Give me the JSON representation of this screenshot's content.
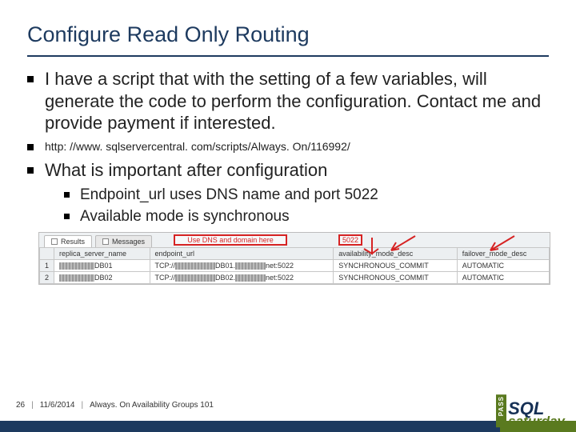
{
  "title": "Configure Read Only Routing",
  "bullets": {
    "b1": "I have a script that with the setting of a few variables, will generate the code to perform the configuration. Contact me and provide payment if interested.",
    "b2": "http: //www. sqlservercentral. com/scripts/Always. On/116992/",
    "b3": "What is important after configuration",
    "b3a": "Endpoint_url uses DNS name and port 5022",
    "b3b": "Available mode is synchronous"
  },
  "shot": {
    "tab1": "Results",
    "tab2": "Messages",
    "callout_dns": "Use DNS and domain here",
    "callout_port": "5022",
    "cols": {
      "c1": "replica_server_name",
      "c2": "endpoint_url",
      "c3": "availability_mode_desc",
      "c4": "failover_mode_desc"
    },
    "rows": [
      {
        "n": "1",
        "c1a": "DB01",
        "c2a": "TCP://",
        "c2b": "DB01.",
        "c2c": "net:5022",
        "c3": "SYNCHRONOUS_COMMIT",
        "c4": "AUTOMATIC"
      },
      {
        "n": "2",
        "c1a": "DB02",
        "c2a": "TCP://",
        "c2b": "DB02.",
        "c2c": "net:5022",
        "c3": "SYNCHRONOUS_COMMIT",
        "c4": "AUTOMATIC"
      }
    ]
  },
  "footer": {
    "page": "26",
    "date": "11/6/2014",
    "topic": "Always. On Availability Groups 101",
    "logo_pass": "PASS",
    "logo_sql": "SQL",
    "logo_sat": "saturday"
  }
}
